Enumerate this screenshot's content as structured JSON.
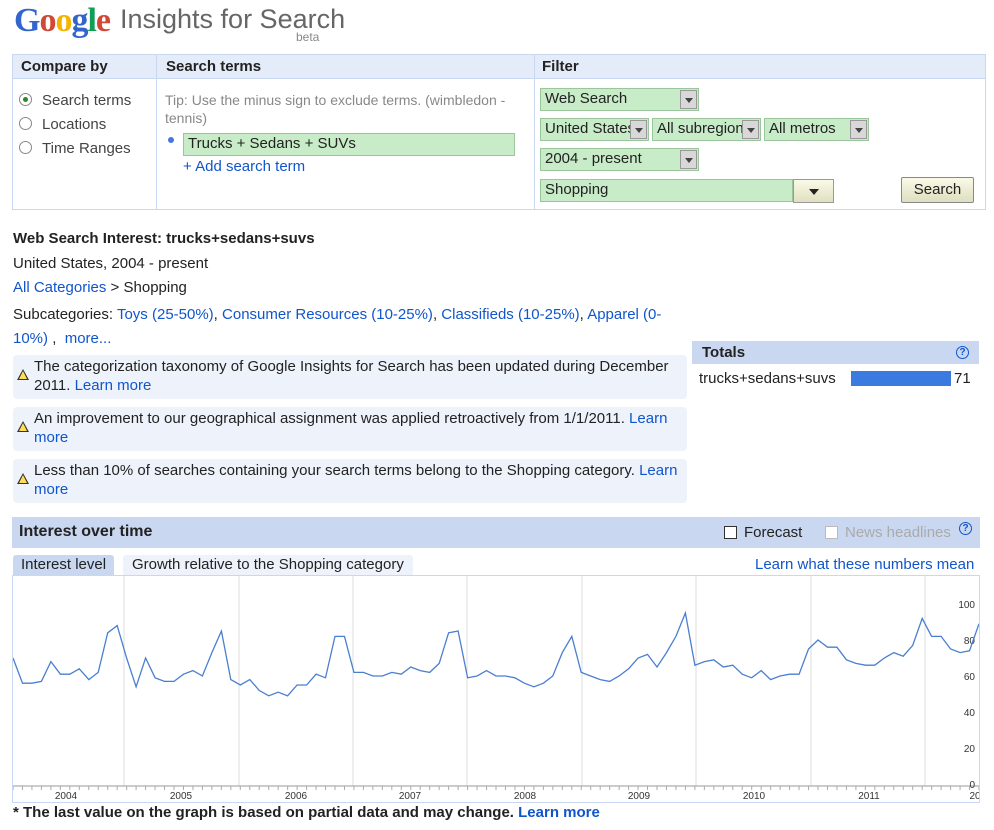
{
  "header": {
    "logo_letters": [
      "G",
      "o",
      "o",
      "g",
      "l",
      "e"
    ],
    "product": "Insights for Search",
    "beta": "beta"
  },
  "panel": {
    "compare_by_label": "Compare by",
    "search_terms_label": "Search terms",
    "filter_label": "Filter",
    "compare_options": [
      {
        "label": "Search terms",
        "selected": true
      },
      {
        "label": "Locations",
        "selected": false
      },
      {
        "label": "Time Ranges",
        "selected": false
      }
    ],
    "tip": "Tip: Use the minus sign to exclude terms. (wimbledon -tennis)",
    "term_value": "Trucks + Sedans + SUVs",
    "add_term": "+ Add search term",
    "filters": {
      "search_type": "Web Search",
      "country": "United States",
      "subregion": "All subregions",
      "metro": "All metros",
      "time_range": "2004 - present",
      "category": "Shopping"
    },
    "search_button": "Search"
  },
  "info": {
    "title": "Web Search Interest: trucks+sedans+suvs",
    "subtitle": "United States, 2004 - present",
    "crumb_link": "All Categories",
    "crumb_sep": " > ",
    "crumb_current": "Shopping",
    "subcategories_label": "Subcategories: ",
    "subcategories": [
      "Toys (25-50%)",
      "Consumer Resources (10-25%)",
      "Classifieds (10-25%)",
      "Apparel (0-10%)"
    ],
    "more": "more..."
  },
  "notices": [
    {
      "text": "The categorization taxonomy of Google Insights for Search has been updated during December 2011. ",
      "link": "Learn more"
    },
    {
      "text": "An improvement to our geographical assignment was applied retroactively from 1/1/2011. ",
      "link": "Learn more"
    },
    {
      "text": "Less than 10% of searches containing your search terms belong to the Shopping category. ",
      "link": "Learn more"
    }
  ],
  "totals": {
    "title": "Totals",
    "term": "trucks+sedans+suvs",
    "value": "71",
    "value_number": 71
  },
  "interest_over_time": {
    "title": "Interest over time",
    "forecast_label": "Forecast",
    "news_label": "News headlines",
    "tab_interest": "Interest level",
    "tab_growth": "Growth relative to the Shopping category",
    "learn_numbers": "Learn what these numbers mean",
    "footnote_text": "* The last value on the graph is based on partial data and may change. ",
    "footnote_link": "Learn more"
  },
  "chart_data": {
    "type": "line",
    "title": "",
    "xlabel": "",
    "ylabel": "",
    "ylim": [
      0,
      110
    ],
    "yticks": [
      0,
      20,
      40,
      60,
      80,
      100
    ],
    "x_tick_labels": [
      "2004",
      "2005",
      "2006",
      "2007",
      "2008",
      "2009",
      "2010",
      "2011",
      "20"
    ],
    "grid": true,
    "line_color": "#4a7fd0",
    "series": [
      {
        "values": [
          70,
          56,
          56,
          57,
          68,
          61,
          61,
          64,
          58,
          62,
          84,
          88,
          70,
          54,
          70,
          59,
          57,
          57,
          61,
          63,
          60,
          73,
          85,
          58,
          55,
          58,
          52,
          49,
          51,
          49,
          55,
          55,
          61,
          59,
          82,
          82,
          62,
          62,
          60,
          60,
          62,
          61,
          65,
          63,
          62,
          67,
          84,
          85,
          59,
          60,
          63,
          60,
          60,
          59,
          56,
          54,
          56,
          60,
          73,
          82,
          62,
          60,
          58,
          57,
          60,
          64,
          70,
          72,
          65,
          73,
          82,
          95,
          66,
          68,
          69,
          65,
          66,
          61,
          59,
          63,
          58,
          60,
          61,
          61,
          75,
          80,
          76,
          76,
          69,
          67,
          66,
          66,
          70,
          73,
          71,
          77,
          92,
          82,
          82,
          75,
          73,
          74,
          89
        ]
      }
    ]
  }
}
